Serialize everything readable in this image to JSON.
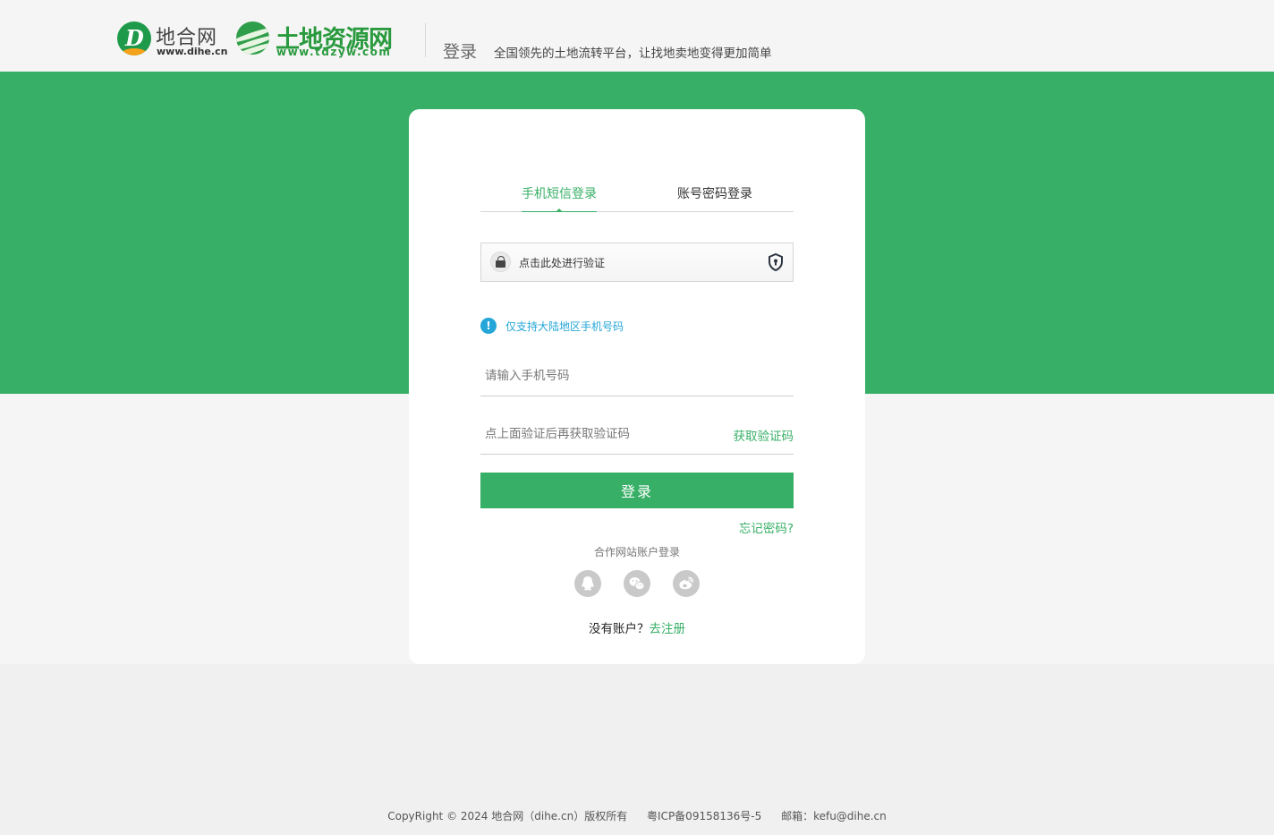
{
  "header": {
    "logo_dihe_cn": "地合网",
    "logo_dihe_en": "www.dihe.cn",
    "logo_tdzy_cn": "土地资源网",
    "logo_tdzy_en": "www.tdzyw.com",
    "page_title": "登录",
    "slogan": "全国领先的土地流转平台，让找地卖地变得更加简单"
  },
  "login": {
    "tabs": [
      {
        "label": "手机短信登录",
        "active": true
      },
      {
        "label": "账号密码登录",
        "active": false
      }
    ],
    "verify_text": "点击此处进行验证",
    "notice": "仅支持大陆地区手机号码",
    "phone_placeholder": "请输入手机号码",
    "code_placeholder": "点上面验证后再获取验证码",
    "get_code": "获取验证码",
    "submit": "登录",
    "forgot": "忘记密码?",
    "partner_label": "合作网站账户登录",
    "social": [
      "qq-icon",
      "wechat-icon",
      "weibo-icon"
    ],
    "no_account": "没有账户？",
    "register": "去注册"
  },
  "footer": {
    "copyright": "CopyRight © 2024 地合网（dihe.cn）版权所有",
    "icp": "粤ICP备09158136号-5",
    "email": "邮箱：kefu@dihe.cn"
  },
  "colors": {
    "brand_green": "#37af66",
    "notice_blue": "#24a6d8",
    "header_bg": "#f5f5f5"
  }
}
